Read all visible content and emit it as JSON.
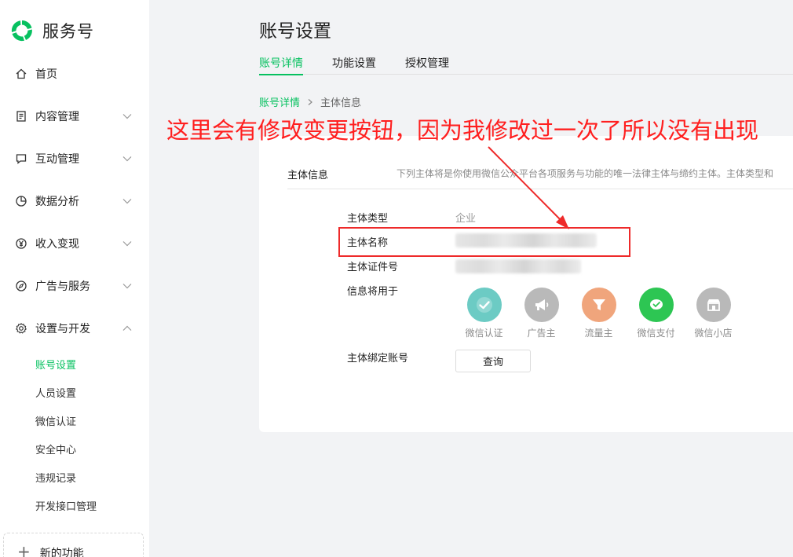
{
  "brand": {
    "name": "服务号",
    "logo_icon": "wechat-service-logo",
    "accent": "#07c160"
  },
  "sidebar": {
    "items": [
      {
        "label": "首页",
        "icon": "home-icon",
        "has_chevron": false
      },
      {
        "label": "内容管理",
        "icon": "document-icon",
        "has_chevron": true,
        "expanded": false
      },
      {
        "label": "互动管理",
        "icon": "chat-icon",
        "has_chevron": true,
        "expanded": false
      },
      {
        "label": "数据分析",
        "icon": "pie-chart-icon",
        "has_chevron": true,
        "expanded": false
      },
      {
        "label": "收入变现",
        "icon": "yen-icon",
        "has_chevron": true,
        "expanded": false
      },
      {
        "label": "广告与服务",
        "icon": "compass-icon",
        "has_chevron": true,
        "expanded": false
      },
      {
        "label": "设置与开发",
        "icon": "gear-icon",
        "has_chevron": true,
        "expanded": true
      }
    ],
    "subitems": [
      {
        "label": "账号设置",
        "active": true
      },
      {
        "label": "人员设置",
        "active": false
      },
      {
        "label": "微信认证",
        "active": false
      },
      {
        "label": "安全中心",
        "active": false
      },
      {
        "label": "违规记录",
        "active": false
      },
      {
        "label": "开发接口管理",
        "active": false
      }
    ],
    "new_feature": {
      "label": "新的功能",
      "icon": "plus-icon"
    }
  },
  "header": {
    "title": "账号设置",
    "tabs": [
      {
        "label": "账号详情",
        "active": true
      },
      {
        "label": "功能设置",
        "active": false
      },
      {
        "label": "授权管理",
        "active": false
      }
    ]
  },
  "breadcrumb": {
    "parent": "账号详情",
    "current": "主体信息"
  },
  "card": {
    "section_title": "主体信息",
    "section_desc": "下列主体将是你使用微信公众平台各项服务与功能的唯一法律主体与缔约主体。主体类型和",
    "rows": {
      "type_label": "主体类型",
      "type_value": "企业",
      "name_label": "主体名称",
      "id_label": "主体证件号",
      "uses_label": "信息将用于",
      "bind_label": "主体绑定账号"
    },
    "uses": [
      {
        "label": "微信认证",
        "icon": "check-icon",
        "color": "#6ccbc4"
      },
      {
        "label": "广告主",
        "icon": "megaphone-icon",
        "color": "#b9b9b9"
      },
      {
        "label": "流量主",
        "icon": "funnel-icon",
        "color": "#f0a57c"
      },
      {
        "label": "微信支付",
        "icon": "wechat-pay-icon",
        "color": "#2dc653"
      },
      {
        "label": "微信小店",
        "icon": "store-icon",
        "color": "#b9b9b9"
      }
    ],
    "query_button": "查询"
  },
  "annotation": {
    "text": "这里会有修改变更按钮，因为我修改过一次了所以没有出现",
    "color": "#ff1f1f"
  }
}
